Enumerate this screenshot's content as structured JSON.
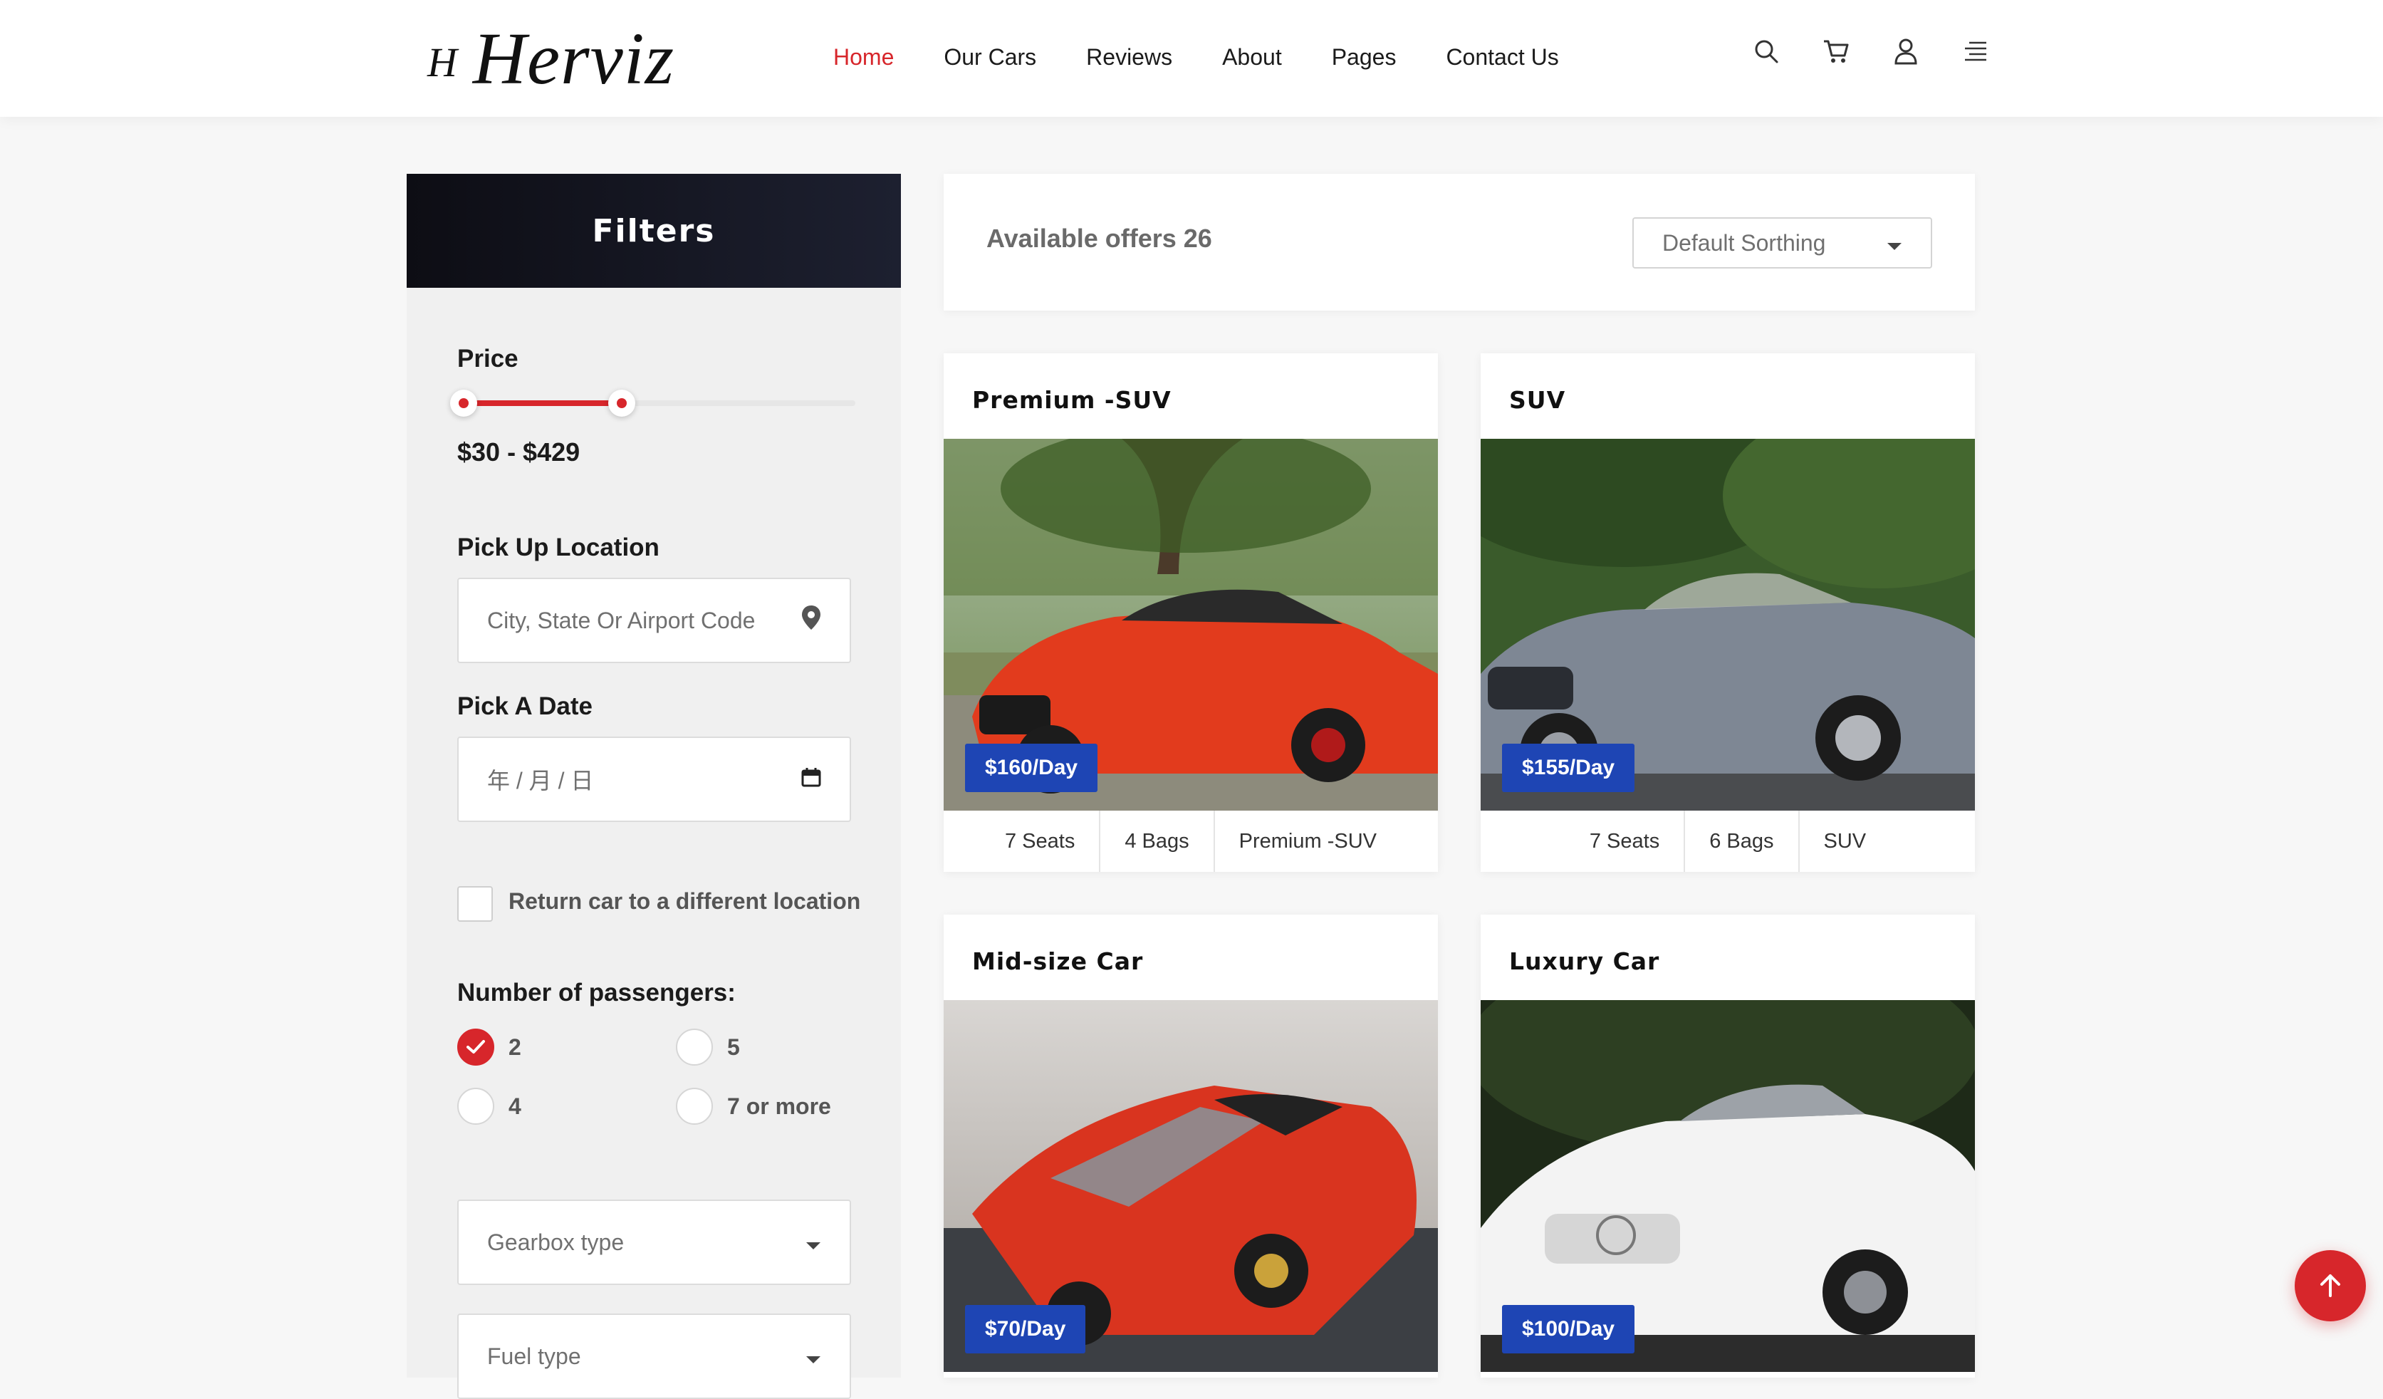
{
  "brand": {
    "mark": "H",
    "name": "Herviz"
  },
  "nav": [
    {
      "label": "Home",
      "active": true
    },
    {
      "label": "Our Cars",
      "active": false
    },
    {
      "label": "Reviews",
      "active": false
    },
    {
      "label": "About",
      "active": false
    },
    {
      "label": "Pages",
      "active": false
    },
    {
      "label": "Contact Us",
      "active": false
    }
  ],
  "header_icons": [
    "search-icon",
    "cart-icon",
    "user-icon",
    "menu-icon"
  ],
  "filters": {
    "title": "Filters",
    "price_label": "Price",
    "price_range": "$30 - $429",
    "price_min_fraction": 0.0,
    "price_max_fraction": 0.4,
    "pickup_label": "Pick Up Location",
    "pickup_placeholder": "City, State Or Airport Code",
    "date_label": "Pick A Date",
    "date_placeholder": "年 / 月 / 日",
    "return_label": "Return car to a different location",
    "return_checked": false,
    "passengers_label": "Number of passengers:",
    "passengers": [
      {
        "label": "2",
        "checked": true
      },
      {
        "label": "5",
        "checked": false
      },
      {
        "label": "4",
        "checked": false
      },
      {
        "label": "7 or more",
        "checked": false
      }
    ],
    "gearbox_label": "Gearbox type",
    "fuel_label": "Fuel type"
  },
  "results": {
    "offers_text": "Available offers 26",
    "sort_label": "Default Sorthing"
  },
  "cars": [
    {
      "title": "Premium -SUV",
      "price": "$160/Day",
      "specs": [
        "7 Seats",
        "4 Bags",
        "Premium -SUV"
      ],
      "color": "#e23b1d"
    },
    {
      "title": "SUV",
      "price": "$155/Day",
      "specs": [
        "7 Seats",
        "6 Bags",
        "SUV"
      ],
      "color": "#7e8794"
    },
    {
      "title": "Mid-size Car",
      "price": "$70/Day",
      "specs": [],
      "color": "#d9341f"
    },
    {
      "title": "Luxury Car",
      "price": "$100/Day",
      "specs": [],
      "color": "#f3f3f3"
    }
  ],
  "colors": {
    "accent": "#d7262b",
    "badge": "#1e45b4"
  }
}
